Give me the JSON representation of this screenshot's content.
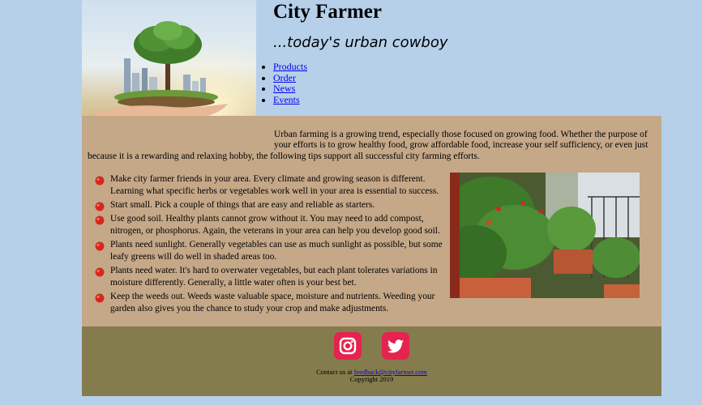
{
  "header": {
    "title": "City Farmer",
    "tagline": "...today's urban cowboy"
  },
  "nav": {
    "items": [
      "Products",
      "Order",
      "News",
      "Events"
    ]
  },
  "content": {
    "intro": "Urban farming is a growing trend, especially those focused on growing food. Whether the purpose of your efforts is to grow healthy food, grow affordable food, increase your self sufficiency, or even just because it is a rewarding and relaxing hobby, the following tips support all successful city farming efforts.",
    "tips": [
      "Make city farmer friends in your area. Every climate and growing season is different. Learning what specific herbs or vegetables work well in your area is essential to success.",
      "Start small. Pick a couple of things that are easy and reliable as starters.",
      "Use good soil. Healthy plants cannot grow without it. You may need to add compost, nitrogen, or phosphorus. Again, the veterans in your area can help you develop good soil.",
      "Plants need sunlight. Generally vegetables can use as much sunlight as possible, but some leafy greens will do well in shaded areas too.",
      "Plants need water. It's hard to overwater vegetables, but each plant tolerates variations in moisture differently. Generally, a little water often is your best bet.",
      "Keep the weeds out. Weeds waste valuable space, moisture and nutrients. Weeding your garden also gives you the chance to study your crop and make adjustments."
    ]
  },
  "footer": {
    "contact_prefix": "Contact us at",
    "email": "feedback@cityfarmer.com",
    "copyright": "Copyright 2019"
  },
  "icons": {
    "bullet": "tomato-icon",
    "social": [
      "instagram-icon",
      "twitter-icon"
    ]
  },
  "colors": {
    "background": "#b6d0ea",
    "content_bg": "#c5a888",
    "footer_bg": "#857c4d",
    "social_button": "#e5234f",
    "link": "#0000ee"
  }
}
